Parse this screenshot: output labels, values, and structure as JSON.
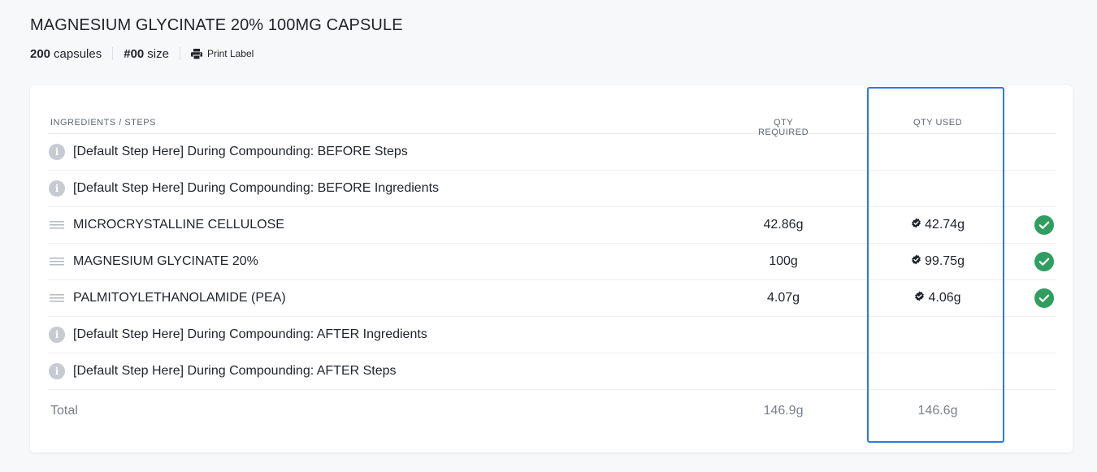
{
  "product": {
    "title": "MAGNESIUM GLYCINATE 20% 100MG CAPSULE",
    "count_value": "200",
    "count_unit": "capsules",
    "size_value": "#00",
    "size_unit": "size",
    "print_label": "Print Label"
  },
  "table": {
    "headers": {
      "name": "INGREDIENTS / STEPS",
      "qty_required": "QTY REQUIRED",
      "qty_used": "QTY USED"
    },
    "rows": [
      {
        "type": "step",
        "icon": "info-icon",
        "name": "[Default Step Here] During Compounding: BEFORE Steps",
        "qty_required": "",
        "qty_used": "",
        "done": false
      },
      {
        "type": "step",
        "icon": "info-icon",
        "name": "[Default Step Here] During Compounding: BEFORE Ingredients",
        "qty_required": "",
        "qty_used": "",
        "done": false
      },
      {
        "type": "ingredient",
        "icon": "drag-handle-icon",
        "name": "MICROCRYSTALLINE CELLULOSE",
        "qty_required": "42.86g",
        "qty_used": "42.74g",
        "done": true
      },
      {
        "type": "ingredient",
        "icon": "drag-handle-icon",
        "name": "MAGNESIUM GLYCINATE 20%",
        "qty_required": "100g",
        "qty_used": "99.75g",
        "done": true
      },
      {
        "type": "ingredient",
        "icon": "drag-handle-icon",
        "name": "PALMITOYLETHANOLAMIDE (PEA)",
        "qty_required": "4.07g",
        "qty_used": "4.06g",
        "done": true
      },
      {
        "type": "step",
        "icon": "info-icon",
        "name": "[Default Step Here] During Compounding: AFTER Ingredients",
        "qty_required": "",
        "qty_used": "",
        "done": false
      },
      {
        "type": "step",
        "icon": "info-icon",
        "name": "[Default Step Here] During Compounding: AFTER Steps",
        "qty_required": "",
        "qty_used": "",
        "done": false
      }
    ],
    "total": {
      "label": "Total",
      "qty_required": "146.9g",
      "qty_used": "146.6g"
    }
  },
  "colors": {
    "success": "#2f9e5f",
    "highlight": "#2a7ae2",
    "info_icon": "#c6cbd2"
  }
}
